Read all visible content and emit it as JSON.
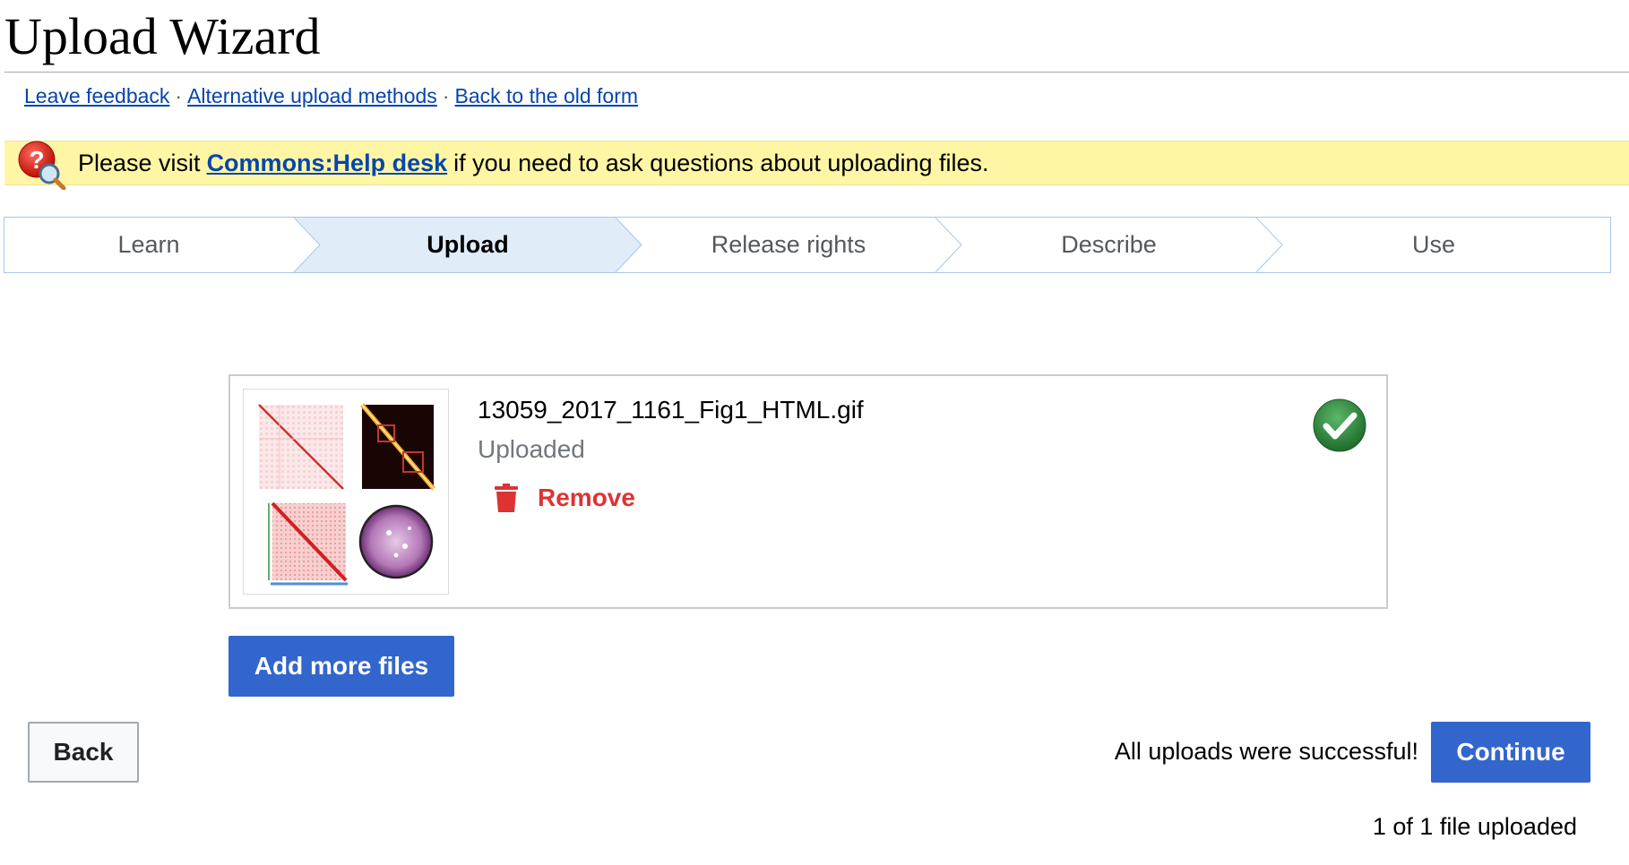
{
  "page": {
    "title": "Upload Wizard"
  },
  "header_links": [
    {
      "label": "Leave feedback"
    },
    {
      "label": "Alternative upload methods"
    },
    {
      "label": "Back to the old form"
    }
  ],
  "separator": "·",
  "notice": {
    "prefix": "Please visit",
    "link": "Commons:Help desk",
    "suffix": "if you need to ask questions about uploading files.",
    "icon": "help-magnifier-icon"
  },
  "steps": [
    {
      "label": "Learn",
      "active": false
    },
    {
      "label": "Upload",
      "active": true
    },
    {
      "label": "Release rights",
      "active": false
    },
    {
      "label": "Describe",
      "active": false
    },
    {
      "label": "Use",
      "active": false
    }
  ],
  "file": {
    "name": "13059_2017_1161_Fig1_HTML.gif",
    "status": "Uploaded",
    "remove_label": "Remove",
    "status_icon": "check-circle-icon"
  },
  "buttons": {
    "add_more": "Add more files",
    "back": "Back",
    "continue": "Continue"
  },
  "messages": {
    "success": "All uploads were successful!",
    "count": "1 of 1 file uploaded"
  },
  "colors": {
    "link": "#0645ad",
    "primary": "#3366cc",
    "notice_bg": "#fef6a5",
    "active_step_bg": "#e0ecf8",
    "remove": "#d33333",
    "success": "#2e8b3a"
  }
}
